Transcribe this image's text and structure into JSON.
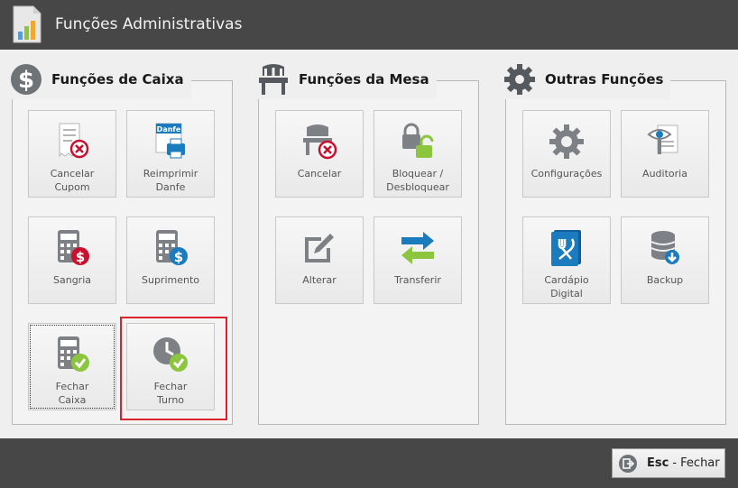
{
  "window": {
    "title": "Funções Administrativas"
  },
  "groups": {
    "caixa": {
      "title": "Funções de Caixa"
    },
    "mesa": {
      "title": "Funções da Mesa"
    },
    "outras": {
      "title": "Outras Funções"
    }
  },
  "tiles": {
    "cancelar_cupom": {
      "line1": "Cancelar",
      "line2": "Cupom"
    },
    "reimprimir_danfe": {
      "line1": "Reimprimir",
      "line2": "Danfe",
      "badge": "Danfe"
    },
    "sangria": {
      "line1": "Sangria"
    },
    "suprimento": {
      "line1": "Suprimento"
    },
    "fechar_caixa": {
      "line1": "Fechar",
      "line2": "Caixa"
    },
    "fechar_turno": {
      "line1": "Fechar",
      "line2": "Turno"
    },
    "cancelar_mesa": {
      "line1": "Cancelar"
    },
    "bloquear": {
      "line1": "Bloquear /",
      "line2": "Desbloquear"
    },
    "alterar": {
      "line1": "Alterar"
    },
    "transferir": {
      "line1": "Transferir"
    },
    "configuracoes": {
      "line1": "Configurações"
    },
    "auditoria": {
      "line1": "Auditoria"
    },
    "cardapio": {
      "line1": "Cardápio",
      "line2": "Digital"
    },
    "backup": {
      "line1": "Backup"
    }
  },
  "footer": {
    "close_key": "Esc",
    "close_label": "- Fechar"
  },
  "colors": {
    "bar": "#474747",
    "highlight": "#d9232d",
    "red": "#c8102e",
    "green": "#8cc63f",
    "blue": "#1a7bbf",
    "gray": "#7d8186"
  }
}
